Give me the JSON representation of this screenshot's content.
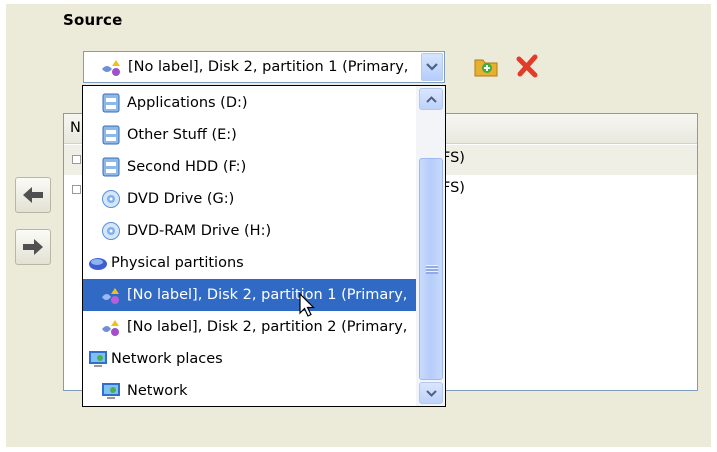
{
  "source": {
    "title": "Source",
    "selected_value": "[No label], Disk 2, partition 1 (Primary,"
  },
  "background_list": {
    "header_visible": "N",
    "rows": [
      "FS)",
      "FS)"
    ]
  },
  "dropdown": {
    "items": [
      {
        "label": "Applications (D:)",
        "icon": "drive-icon",
        "group": false
      },
      {
        "label": "Other Stuff (E:)",
        "icon": "drive-icon",
        "group": false
      },
      {
        "label": "Second HDD (F:)",
        "icon": "drive-icon",
        "group": false
      },
      {
        "label": "DVD Drive (G:)",
        "icon": "dvd-icon",
        "group": false
      },
      {
        "label": "DVD-RAM Drive (H:)",
        "icon": "dvd-icon",
        "group": false
      },
      {
        "label": "Physical partitions",
        "icon": "physical-partitions-icon",
        "group": true
      },
      {
        "label": "[No label], Disk 2, partition 1 (Primary,",
        "icon": "partition-icon",
        "group": false,
        "selected": true
      },
      {
        "label": "[No label], Disk 2, partition 2 (Primary,",
        "icon": "partition-icon",
        "group": false
      },
      {
        "label": "Network places",
        "icon": "network-places-icon",
        "group": true
      },
      {
        "label": "Network",
        "icon": "network-icon",
        "group": false
      }
    ]
  },
  "colors": {
    "panel_bg": "#ecead8",
    "selection": "#316ac5",
    "border": "#7f9db9"
  }
}
